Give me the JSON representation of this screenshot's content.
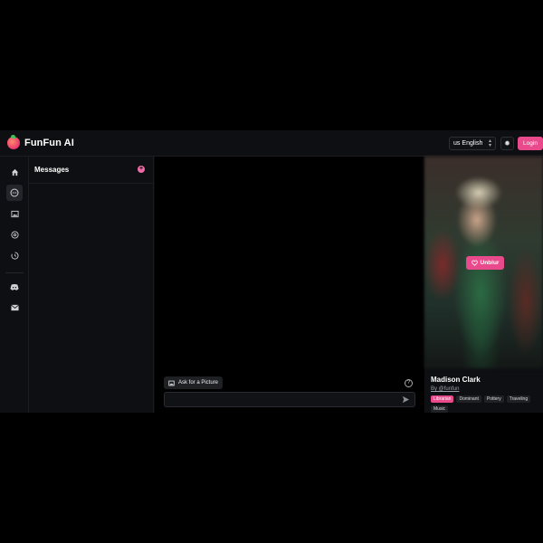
{
  "header": {
    "brand": "FunFun AI",
    "language": {
      "flag": "us",
      "label": "English"
    },
    "login_label": "Login"
  },
  "rail": {
    "items": [
      {
        "name": "home",
        "icon": "home-icon",
        "active": false
      },
      {
        "name": "chat",
        "icon": "chat-icon",
        "active": true
      },
      {
        "name": "gallery",
        "icon": "image-icon",
        "active": false
      },
      {
        "name": "create",
        "icon": "plus-circle-icon",
        "active": false
      },
      {
        "name": "history",
        "icon": "history-icon",
        "active": false
      },
      {
        "name": "discord",
        "icon": "discord-icon",
        "active": false
      },
      {
        "name": "mail",
        "icon": "mail-icon",
        "active": false
      }
    ]
  },
  "messages": {
    "title": "Messages",
    "add_label": "+"
  },
  "chat": {
    "ask_picture_label": "Ask for a Picture",
    "input_placeholder": ""
  },
  "profile": {
    "unblur_label": "Unblur",
    "name": "Madison Clark",
    "handle": "By @funfun",
    "tags": [
      {
        "label": "Librarian",
        "primary": true
      },
      {
        "label": "Dominant",
        "primary": false
      },
      {
        "label": "Pottery",
        "primary": false
      },
      {
        "label": "Traveling",
        "primary": false
      },
      {
        "label": "Music",
        "primary": false
      }
    ]
  },
  "colors": {
    "accent": "#e94a8b",
    "background": "#0b0c0e",
    "panel": "#0e0f12"
  }
}
